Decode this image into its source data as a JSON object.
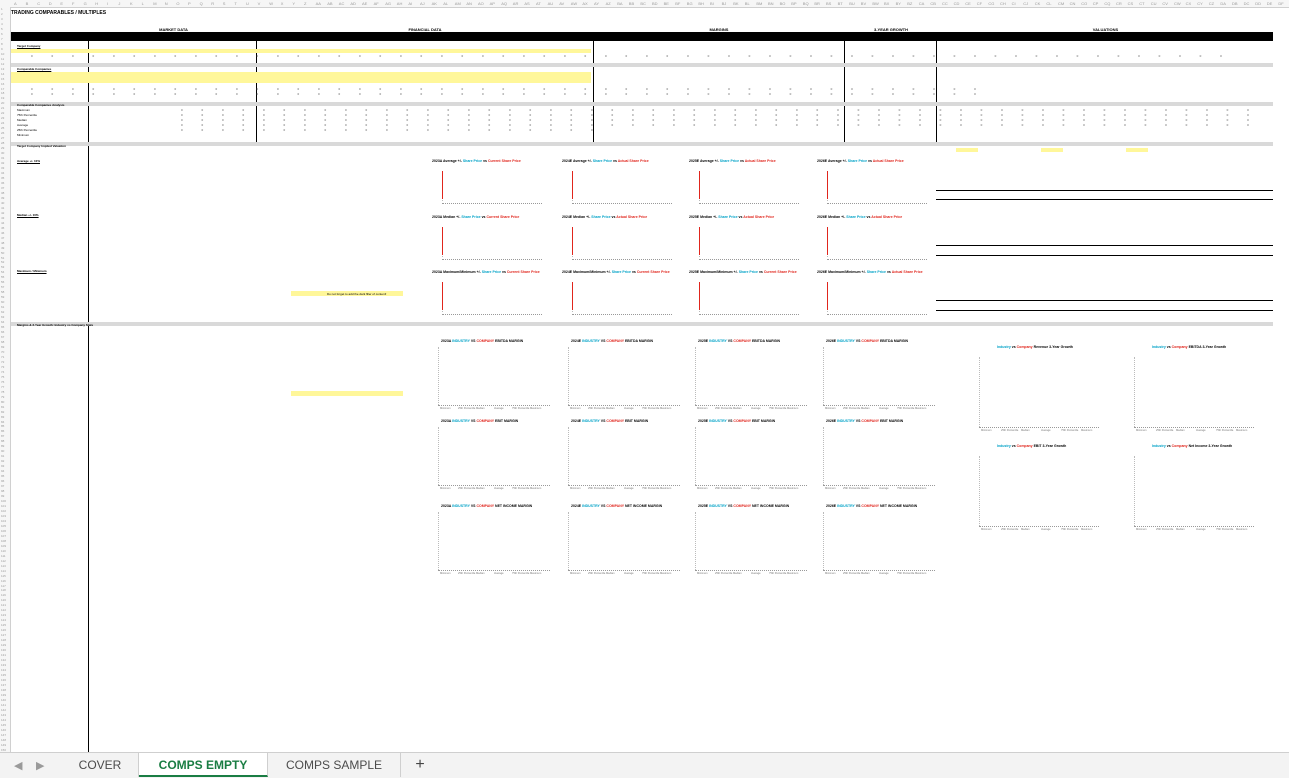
{
  "sheet": {
    "title": "TRADING COMPARABLES / MULTIPLES",
    "sections": {
      "market_data": "MARKET DATA",
      "financial_data": "FINANCIAL DATA",
      "margins": "MARGINS",
      "growth": "3-YEAR GROWTH",
      "valuations": "VALUATIONS"
    },
    "labels": {
      "target_company": "Target Company",
      "comparable_companies": "Comparable Companies",
      "comparable_analysis": "Comparable Companies Analysis",
      "max": "Maximum",
      "p75": "75th Percentile",
      "median": "Median",
      "average": "Average",
      "p25": "25th Percentile",
      "min": "Minimum",
      "implied": "Target Company Implied Valuation",
      "average_block": "Average +/- 10%",
      "median_block": "Median +/- 10%",
      "maxmin_block": "Maximum / Minimum",
      "margins_growth": "Margins & 3-Year Growth: Industry vs Company Stats"
    },
    "hint_text": "Do not forget to add the dark filler of content!"
  },
  "charts": {
    "share_price": [
      "2023A Average +/- Share Price vs Current Share Price",
      "2024E Average +/- Share Price vs Actual Share Price",
      "2025E Average +/- Share Price vs Actual Share Price",
      "2026E Average +/- Share Price vs Actual Share Price",
      "2023A Median +/- Share Price vs Current Share Price",
      "2024E Median +/- Share Price vs Actual Share Price",
      "2025E Median +/- Share Price vs Actual Share Price",
      "2026E Median +/- Share Price vs Actual Share Price",
      "2023A Maximum/Minimum +/- Share Price vs Current Share Price",
      "2024E Maximum/Minimum +/- Share Price vs Current Share Price",
      "2025E Maximum/Minimum +/- Share Price vs Current Share Price",
      "2026E Maximum/Minimum +/- Share Price vs Actual Share Price"
    ],
    "margins": [
      "2023A INDUSTRY VS COMPANY EBITDA MARGIN",
      "2024E INDUSTRY VS COMPANY EBITDA MARGIN",
      "2025E INDUSTRY VS COMPANY EBITDA MARGIN",
      "2026E INDUSTRY VS COMPANY EBITDA MARGIN",
      "2023A INDUSTRY VS COMPANY EBIT MARGIN",
      "2024E INDUSTRY VS COMPANY EBIT MARGIN",
      "2025E INDUSTRY VS COMPANY EBIT MARGIN",
      "2026E INDUSTRY VS COMPANY EBIT MARGIN",
      "2023A INDUSTRY VS COMPANY NET INCOME MARGIN",
      "2024E INDUSTRY VS COMPANY NET INCOME MARGIN",
      "2025E INDUSTRY VS COMPANY NET INCOME MARGIN",
      "2026E INDUSTRY VS COMPANY NET INCOME MARGIN"
    ],
    "growth": [
      "Industry vs Company Revenue 3-Year Growth",
      "Industry vs Company EBITDA 3-Year Growth",
      "Industry vs Company EBIT 3-Year Growth",
      "Industry vs Company Net Income 3-Year Growth"
    ],
    "x_labels": [
      "Minimum",
      "25th Percentile",
      "Median",
      "Average",
      "75th Percentile",
      "Maximum"
    ]
  },
  "tabs": {
    "cover": "COVER",
    "comps_empty": "COMPS EMPTY",
    "comps_sample": "COMPS SAMPLE",
    "add": "+"
  },
  "colors": {
    "accent_green": "#1a7d43",
    "highlight_yellow": "#fff79a",
    "industry_cyan": "#00a2c7",
    "company_red": "#e0261d"
  }
}
